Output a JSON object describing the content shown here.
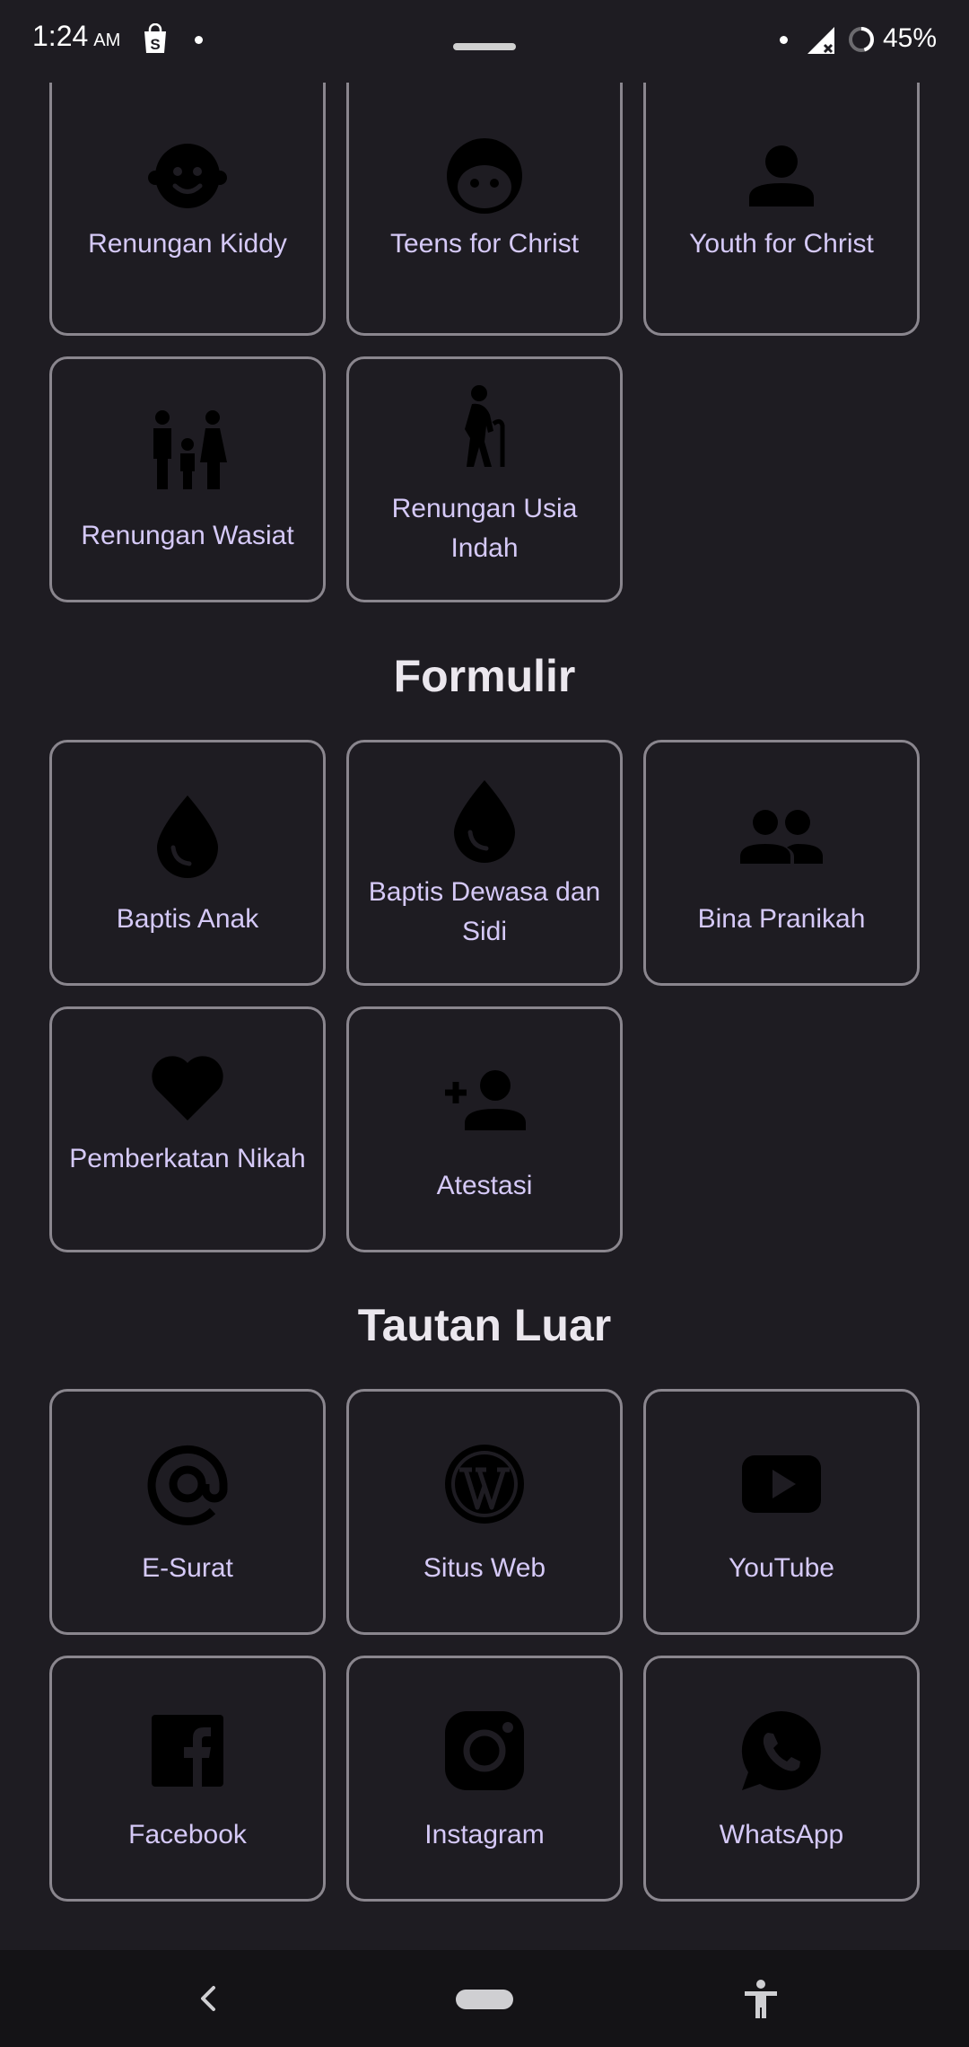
{
  "status_bar": {
    "time": "1:24",
    "ampm": "AM",
    "battery_percent": "45%",
    "icons": [
      "shopping-bag-icon",
      "notification-dot-icon",
      "signal-icon",
      "battery-icon"
    ]
  },
  "top_row": {
    "cards": [
      {
        "label": "Renungan Kiddy",
        "icon": "child-face-icon"
      },
      {
        "label": "Teens for Christ",
        "icon": "face-icon"
      },
      {
        "label": "Youth for Christ",
        "icon": "person-icon"
      }
    ]
  },
  "second_row": {
    "cards": [
      {
        "label": "Renungan Wasiat",
        "icon": "family-icon"
      },
      {
        "label": "Renungan Usia Indah",
        "icon": "elderly-icon"
      }
    ]
  },
  "formulir": {
    "title": "Formulir",
    "cards": [
      {
        "label": "Baptis Anak",
        "icon": "water-drop-icon"
      },
      {
        "label": "Baptis Dewasa dan Sidi",
        "icon": "water-drop-icon"
      },
      {
        "label": "Bina Pranikah",
        "icon": "people-icon"
      },
      {
        "label": "Pemberkatan Nikah",
        "icon": "heart-icon"
      },
      {
        "label": "Atestasi",
        "icon": "person-add-icon"
      }
    ]
  },
  "tautan_luar": {
    "title": "Tautan Luar",
    "cards": [
      {
        "label": "E-Surat",
        "icon": "at-sign-icon"
      },
      {
        "label": "Situs Web",
        "icon": "wordpress-icon"
      },
      {
        "label": "YouTube",
        "icon": "youtube-icon"
      },
      {
        "label": "Facebook",
        "icon": "facebook-icon"
      },
      {
        "label": "Instagram",
        "icon": "instagram-icon"
      },
      {
        "label": "WhatsApp",
        "icon": "whatsapp-icon"
      }
    ]
  },
  "colors": {
    "background": "#1e1c22",
    "card_border": "#8a868e",
    "label": "#d5c9f7",
    "title": "#ebe7ee",
    "icon": "#000000"
  }
}
